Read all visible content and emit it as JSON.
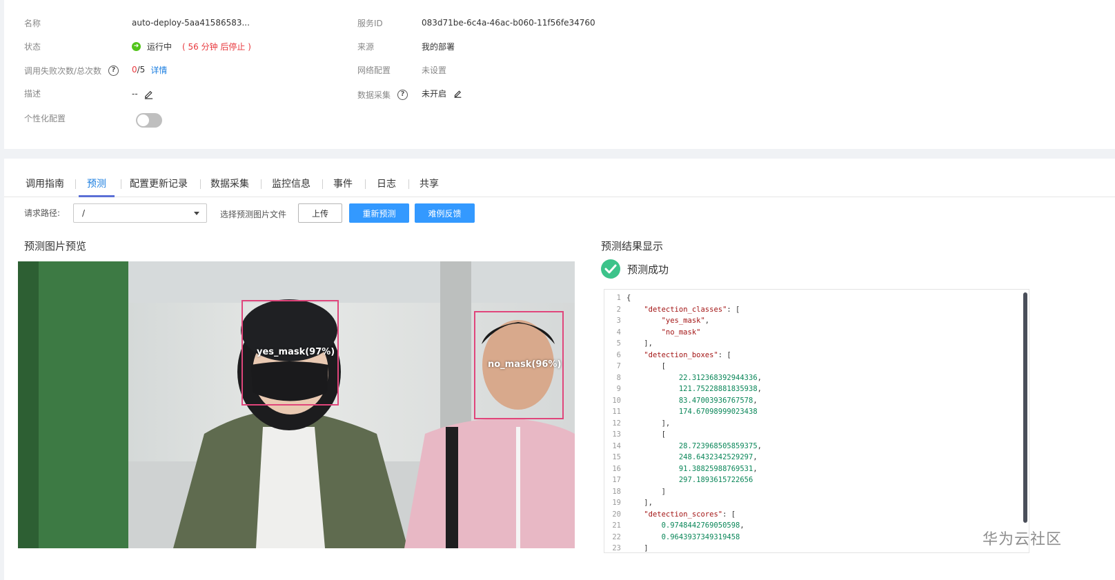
{
  "info": {
    "name_label": "名称",
    "name_value": "auto-deploy-5aa41586583...",
    "service_id_label": "服务ID",
    "service_id_value": "083d71be-6c4a-46ac-b060-11f56fe34760",
    "status_label": "状态",
    "status_value": "运行中",
    "status_note": "( 56 分钟 后停止 )",
    "source_label": "来源",
    "source_value": "我的部署",
    "fail_label": "调用失败次数/总次数",
    "fail_value": "0",
    "fail_total": "/5",
    "detail_link": "详情",
    "network_label": "网络配置",
    "network_value": "未设置",
    "desc_label": "描述",
    "desc_value": "--",
    "data_collect_label": "数据采集",
    "data_collect_value": "未开启",
    "personal_label": "个性化配置",
    "help_glyph": "?"
  },
  "tabs": [
    {
      "label": "调用指南"
    },
    {
      "label": "预测"
    },
    {
      "label": "配置更新记录"
    },
    {
      "label": "数据采集"
    },
    {
      "label": "监控信息"
    },
    {
      "label": "事件"
    },
    {
      "label": "日志"
    },
    {
      "label": "共享"
    }
  ],
  "active_tab": "预测",
  "toolbar": {
    "path_label": "请求路径:",
    "path_value": "/",
    "file_label": "选择预测图片文件",
    "upload_button": "上传",
    "repredict_button": "重新预测",
    "feedback_button": "难例反馈"
  },
  "preview": {
    "title": "预测图片预览",
    "boxes": [
      {
        "label": "yes_mask(97%)"
      },
      {
        "label": "no_mask(96%)"
      }
    ]
  },
  "result": {
    "title": "预测结果显示",
    "success_text": "预测成功",
    "json_lines": [
      "{",
      "    \"detection_classes\": [",
      "        \"yes_mask\",",
      "        \"no_mask\"",
      "    ],",
      "    \"detection_boxes\": [",
      "        [",
      "            22.312368392944336,",
      "            121.75228881835938,",
      "            83.47003936767578,",
      "            174.67098999023438",
      "        ],",
      "        [",
      "            28.723968505859375,",
      "            248.6432342529297,",
      "            91.38825988769531,",
      "            297.1893615722656",
      "        ]",
      "    ],",
      "    \"detection_scores\": [",
      "        0.9748442769050598,",
      "        0.9643937349319458",
      "    ]"
    ]
  },
  "watermark": "华为云社区",
  "colors": {
    "accent": "#1d7fe0",
    "primary_button": "#3399ff",
    "status_green": "#52c41a",
    "success_green": "#3cc38a",
    "warning_red": "#e8383d",
    "box_pink": "#e0457b"
  },
  "icons": {
    "status": "running-dot-icon",
    "edit": "pencil-icon",
    "help": "question-circle-icon",
    "success": "check-circle-icon",
    "dropdown": "caret-down-icon"
  }
}
